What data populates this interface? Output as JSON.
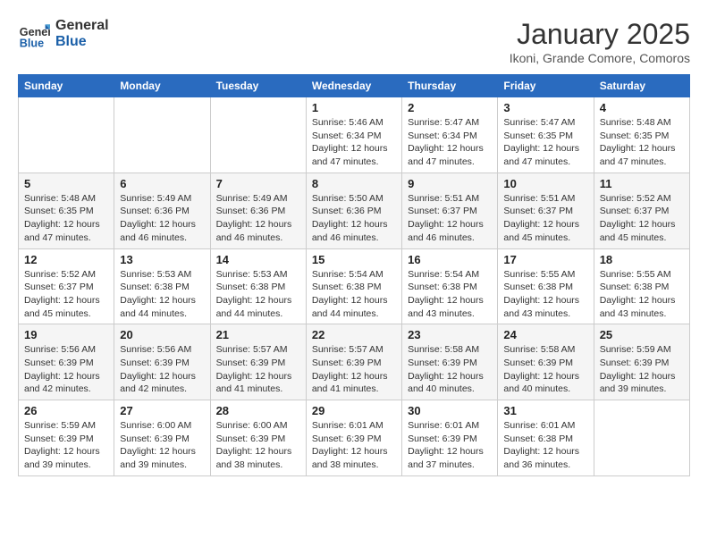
{
  "logo": {
    "text_general": "General",
    "text_blue": "Blue"
  },
  "header": {
    "month": "January 2025",
    "location": "Ikoni, Grande Comore, Comoros"
  },
  "weekdays": [
    "Sunday",
    "Monday",
    "Tuesday",
    "Wednesday",
    "Thursday",
    "Friday",
    "Saturday"
  ],
  "weeks": [
    [
      {
        "day": "",
        "info": ""
      },
      {
        "day": "",
        "info": ""
      },
      {
        "day": "",
        "info": ""
      },
      {
        "day": "1",
        "info": "Sunrise: 5:46 AM\nSunset: 6:34 PM\nDaylight: 12 hours\nand 47 minutes."
      },
      {
        "day": "2",
        "info": "Sunrise: 5:47 AM\nSunset: 6:34 PM\nDaylight: 12 hours\nand 47 minutes."
      },
      {
        "day": "3",
        "info": "Sunrise: 5:47 AM\nSunset: 6:35 PM\nDaylight: 12 hours\nand 47 minutes."
      },
      {
        "day": "4",
        "info": "Sunrise: 5:48 AM\nSunset: 6:35 PM\nDaylight: 12 hours\nand 47 minutes."
      }
    ],
    [
      {
        "day": "5",
        "info": "Sunrise: 5:48 AM\nSunset: 6:35 PM\nDaylight: 12 hours\nand 47 minutes."
      },
      {
        "day": "6",
        "info": "Sunrise: 5:49 AM\nSunset: 6:36 PM\nDaylight: 12 hours\nand 46 minutes."
      },
      {
        "day": "7",
        "info": "Sunrise: 5:49 AM\nSunset: 6:36 PM\nDaylight: 12 hours\nand 46 minutes."
      },
      {
        "day": "8",
        "info": "Sunrise: 5:50 AM\nSunset: 6:36 PM\nDaylight: 12 hours\nand 46 minutes."
      },
      {
        "day": "9",
        "info": "Sunrise: 5:51 AM\nSunset: 6:37 PM\nDaylight: 12 hours\nand 46 minutes."
      },
      {
        "day": "10",
        "info": "Sunrise: 5:51 AM\nSunset: 6:37 PM\nDaylight: 12 hours\nand 45 minutes."
      },
      {
        "day": "11",
        "info": "Sunrise: 5:52 AM\nSunset: 6:37 PM\nDaylight: 12 hours\nand 45 minutes."
      }
    ],
    [
      {
        "day": "12",
        "info": "Sunrise: 5:52 AM\nSunset: 6:37 PM\nDaylight: 12 hours\nand 45 minutes."
      },
      {
        "day": "13",
        "info": "Sunrise: 5:53 AM\nSunset: 6:38 PM\nDaylight: 12 hours\nand 44 minutes."
      },
      {
        "day": "14",
        "info": "Sunrise: 5:53 AM\nSunset: 6:38 PM\nDaylight: 12 hours\nand 44 minutes."
      },
      {
        "day": "15",
        "info": "Sunrise: 5:54 AM\nSunset: 6:38 PM\nDaylight: 12 hours\nand 44 minutes."
      },
      {
        "day": "16",
        "info": "Sunrise: 5:54 AM\nSunset: 6:38 PM\nDaylight: 12 hours\nand 43 minutes."
      },
      {
        "day": "17",
        "info": "Sunrise: 5:55 AM\nSunset: 6:38 PM\nDaylight: 12 hours\nand 43 minutes."
      },
      {
        "day": "18",
        "info": "Sunrise: 5:55 AM\nSunset: 6:38 PM\nDaylight: 12 hours\nand 43 minutes."
      }
    ],
    [
      {
        "day": "19",
        "info": "Sunrise: 5:56 AM\nSunset: 6:39 PM\nDaylight: 12 hours\nand 42 minutes."
      },
      {
        "day": "20",
        "info": "Sunrise: 5:56 AM\nSunset: 6:39 PM\nDaylight: 12 hours\nand 42 minutes."
      },
      {
        "day": "21",
        "info": "Sunrise: 5:57 AM\nSunset: 6:39 PM\nDaylight: 12 hours\nand 41 minutes."
      },
      {
        "day": "22",
        "info": "Sunrise: 5:57 AM\nSunset: 6:39 PM\nDaylight: 12 hours\nand 41 minutes."
      },
      {
        "day": "23",
        "info": "Sunrise: 5:58 AM\nSunset: 6:39 PM\nDaylight: 12 hours\nand 40 minutes."
      },
      {
        "day": "24",
        "info": "Sunrise: 5:58 AM\nSunset: 6:39 PM\nDaylight: 12 hours\nand 40 minutes."
      },
      {
        "day": "25",
        "info": "Sunrise: 5:59 AM\nSunset: 6:39 PM\nDaylight: 12 hours\nand 39 minutes."
      }
    ],
    [
      {
        "day": "26",
        "info": "Sunrise: 5:59 AM\nSunset: 6:39 PM\nDaylight: 12 hours\nand 39 minutes."
      },
      {
        "day": "27",
        "info": "Sunrise: 6:00 AM\nSunset: 6:39 PM\nDaylight: 12 hours\nand 39 minutes."
      },
      {
        "day": "28",
        "info": "Sunrise: 6:00 AM\nSunset: 6:39 PM\nDaylight: 12 hours\nand 38 minutes."
      },
      {
        "day": "29",
        "info": "Sunrise: 6:01 AM\nSunset: 6:39 PM\nDaylight: 12 hours\nand 38 minutes."
      },
      {
        "day": "30",
        "info": "Sunrise: 6:01 AM\nSunset: 6:39 PM\nDaylight: 12 hours\nand 37 minutes."
      },
      {
        "day": "31",
        "info": "Sunrise: 6:01 AM\nSunset: 6:38 PM\nDaylight: 12 hours\nand 36 minutes."
      },
      {
        "day": "",
        "info": ""
      }
    ]
  ]
}
